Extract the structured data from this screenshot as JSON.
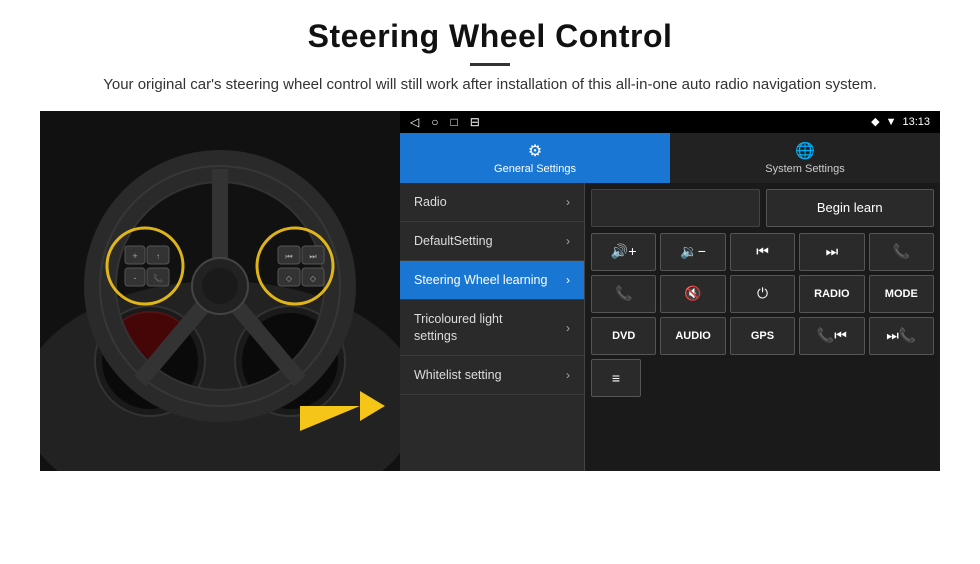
{
  "header": {
    "title": "Steering Wheel Control",
    "subtitle": "Your original car's steering wheel control will still work after installation of this all-in-one auto radio navigation system."
  },
  "statusBar": {
    "leftIcons": [
      "◁",
      "○",
      "□",
      "⊟"
    ],
    "rightIcons": [
      "◆",
      "▼",
      "13:13"
    ]
  },
  "tabs": [
    {
      "id": "general",
      "label": "General Settings",
      "icon": "⚙",
      "active": true
    },
    {
      "id": "system",
      "label": "System Settings",
      "icon": "🌐",
      "active": false
    }
  ],
  "menuItems": [
    {
      "id": "radio",
      "label": "Radio",
      "active": false
    },
    {
      "id": "default",
      "label": "DefaultSetting",
      "active": false
    },
    {
      "id": "steering",
      "label": "Steering Wheel learning",
      "active": true
    },
    {
      "id": "tricolour",
      "label": "Tricoloured light settings",
      "active": false
    },
    {
      "id": "whitelist",
      "label": "Whitelist setting",
      "active": false
    }
  ],
  "beginLearnLabel": "Begin learn",
  "controlButtons": {
    "row1": [
      {
        "id": "vol-up",
        "icon": "🔊+",
        "type": "icon"
      },
      {
        "id": "vol-down",
        "icon": "🔉-",
        "type": "icon"
      },
      {
        "id": "prev-track",
        "icon": "⏮",
        "type": "icon"
      },
      {
        "id": "next-track",
        "icon": "⏭",
        "type": "icon"
      },
      {
        "id": "phone",
        "icon": "📞",
        "type": "icon"
      }
    ],
    "row2": [
      {
        "id": "call-answer",
        "icon": "📞",
        "type": "icon"
      },
      {
        "id": "mute",
        "icon": "🔇",
        "type": "icon"
      },
      {
        "id": "power",
        "icon": "⏻",
        "type": "icon"
      },
      {
        "id": "radio-btn",
        "icon": "RADIO",
        "type": "text"
      },
      {
        "id": "mode-btn",
        "icon": "MODE",
        "type": "text"
      }
    ],
    "row3": [
      {
        "id": "dvd",
        "icon": "DVD",
        "type": "text"
      },
      {
        "id": "audio",
        "icon": "AUDIO",
        "type": "text"
      },
      {
        "id": "gps",
        "icon": "GPS",
        "type": "text"
      },
      {
        "id": "phone2",
        "icon": "📞⏮",
        "type": "icon"
      },
      {
        "id": "skip",
        "icon": "⏭📞",
        "type": "icon"
      }
    ],
    "row4": [
      {
        "id": "list",
        "icon": "≡",
        "type": "icon"
      }
    ]
  }
}
